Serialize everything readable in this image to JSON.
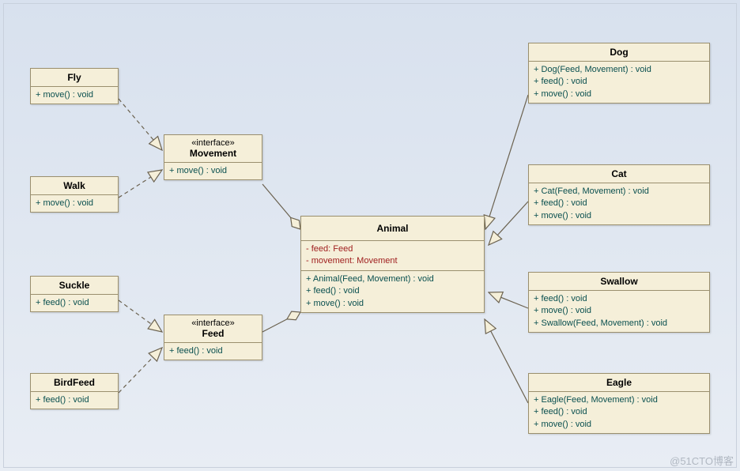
{
  "watermark": "@51CTO博客",
  "classes": {
    "fly": {
      "name": "Fly",
      "members": [
        "+  move() : void"
      ]
    },
    "walk": {
      "name": "Walk",
      "members": [
        "+  move() : void"
      ]
    },
    "suckle": {
      "name": "Suckle",
      "members": [
        "+  feed() : void"
      ]
    },
    "birdfeed": {
      "name": "BirdFeed",
      "members": [
        "+  feed() : void"
      ]
    },
    "movement": {
      "stereotype": "«interface»",
      "name": "Movement",
      "members": [
        "+  move() : void"
      ]
    },
    "feed": {
      "stereotype": "«interface»",
      "name": "Feed",
      "members": [
        "+  feed() : void"
      ]
    },
    "animal": {
      "name": "Animal",
      "attributes": [
        "-   feed:  Feed",
        "-   movement:  Movement"
      ],
      "members": [
        "+  Animal(Feed, Movement) : void",
        "+  feed() : void",
        "+  move() : void"
      ]
    },
    "dog": {
      "name": "Dog",
      "members": [
        "+  Dog(Feed, Movement) : void",
        "+  feed() : void",
        "+  move() : void"
      ]
    },
    "cat": {
      "name": "Cat",
      "members": [
        "+  Cat(Feed, Movement) : void",
        "+  feed() : void",
        "+  move() : void"
      ]
    },
    "swallow": {
      "name": "Swallow",
      "members": [
        "+  feed() : void",
        "+  move() : void",
        "+  Swallow(Feed, Movement) : void"
      ]
    },
    "eagle": {
      "name": "Eagle",
      "members": [
        "+  Eagle(Feed, Movement) : void",
        "+  feed() : void",
        "+  move() : void"
      ]
    }
  }
}
